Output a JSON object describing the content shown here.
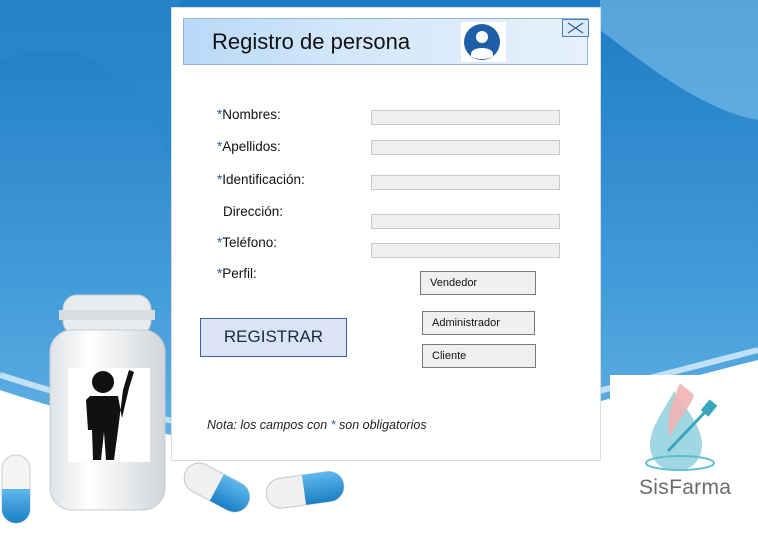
{
  "dialog": {
    "title": "Registro de persona",
    "close_icon": "close-icon",
    "avatar_icon": "user-avatar-icon"
  },
  "form": {
    "required_marker": "*",
    "fields": [
      {
        "label": "Nombres:",
        "required": true,
        "value": ""
      },
      {
        "label": "Apellidos:",
        "required": true,
        "value": ""
      },
      {
        "label": "Identificación:",
        "required": true,
        "value": ""
      },
      {
        "label": "Dirección:",
        "required": false,
        "value": ""
      },
      {
        "label": "Teléfono:",
        "required": true,
        "value": ""
      }
    ],
    "profile_label": "Perfil:",
    "profile_options": [
      "Vendedor",
      "Administrador",
      "Cliente"
    ],
    "register_label": "REGISTRAR",
    "note_prefix": "Nota: los campos con ",
    "note_marker": "*",
    "note_suffix": " son obligatorios"
  },
  "brand": {
    "name": "SisFarma",
    "accent": "#2a5aa8"
  }
}
